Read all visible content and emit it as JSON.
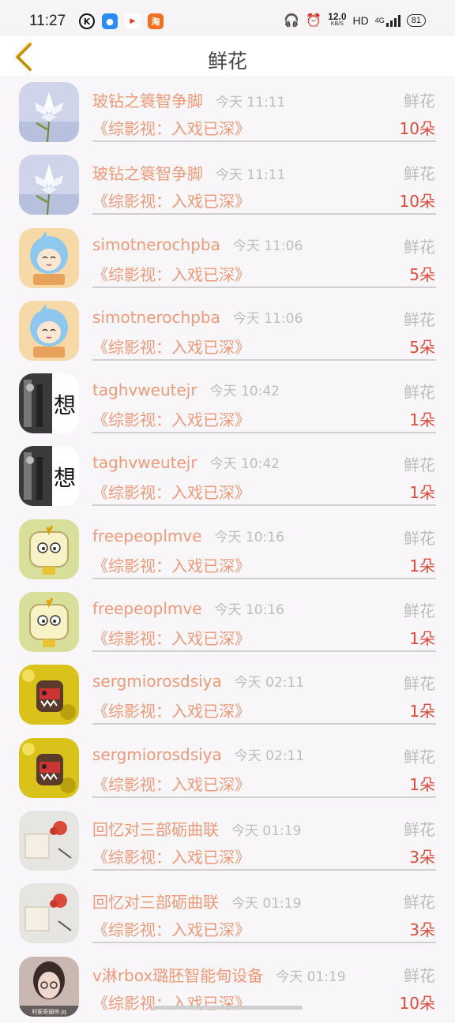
{
  "status_bar": {
    "time": "11:27",
    "speed_value": "12.0",
    "speed_unit": "KB/S",
    "hd": "HD",
    "network": "4G",
    "battery": "81"
  },
  "header": {
    "title": "鲜花"
  },
  "rows": [
    {
      "name": "玻钻之簑智争脚",
      "time": "今天 11:11",
      "book": "《综影视：入戏已深》",
      "gift": "鲜花",
      "count": "10朵"
    },
    {
      "name": "玻钻之簑智争脚",
      "time": "今天 11:11",
      "book": "《综影视：入戏已深》",
      "gift": "鲜花",
      "count": "10朵"
    },
    {
      "name": "simotnerochpba",
      "time": "今天 11:06",
      "book": "《综影视：入戏已深》",
      "gift": "鲜花",
      "count": "5朵"
    },
    {
      "name": "simotnerochpba",
      "time": "今天 11:06",
      "book": "《综影视：入戏已深》",
      "gift": "鲜花",
      "count": "5朵"
    },
    {
      "name": "taghvweutejr",
      "time": "今天 10:42",
      "book": "《综影视：入戏已深》",
      "gift": "鲜花",
      "count": "1朵"
    },
    {
      "name": "taghvweutejr",
      "time": "今天 10:42",
      "book": "《综影视：入戏已深》",
      "gift": "鲜花",
      "count": "1朵"
    },
    {
      "name": "freepeoplmve",
      "time": "今天 10:16",
      "book": "《综影视：入戏已深》",
      "gift": "鲜花",
      "count": "1朵"
    },
    {
      "name": "freepeoplmve",
      "time": "今天 10:16",
      "book": "《综影视：入戏已深》",
      "gift": "鲜花",
      "count": "1朵"
    },
    {
      "name": "sergmiorosdsiya",
      "time": "今天 02:11",
      "book": "《综影视：入戏已深》",
      "gift": "鲜花",
      "count": "1朵"
    },
    {
      "name": "sergmiorosdsiya",
      "time": "今天 02:11",
      "book": "《综影视：入戏已深》",
      "gift": "鲜花",
      "count": "1朵"
    },
    {
      "name": "回忆对三部砺曲联",
      "time": "今天 01:19",
      "book": "《综影视：入戏已深》",
      "gift": "鲜花",
      "count": "3朵"
    },
    {
      "name": "回忆对三部砺曲联",
      "time": "今天 01:19",
      "book": "《综影视：入戏已深》",
      "gift": "鲜花",
      "count": "3朵"
    },
    {
      "name": "v淋rbox璐胚智能甸设备",
      "time": "今天 01:19",
      "book": "《综影视：入戏已深》",
      "gift": "鲜花",
      "count": "10朵"
    }
  ],
  "avatar_text": {
    "taghv": "想",
    "last": "村家奇翅帅.jq"
  }
}
